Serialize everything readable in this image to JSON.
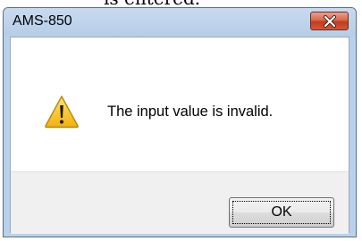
{
  "page": {
    "top_text": "is entered."
  },
  "dialog": {
    "title": "AMS-850",
    "message": "The input value is invalid.",
    "ok_label": "OK",
    "icon": "warning-icon",
    "close_icon": "close-icon"
  },
  "colors": {
    "titlebar": "#b9d1ea",
    "close_button": "#c94a2c",
    "button_area": "#f0f0f0",
    "warning_yellow": "#f5c21a"
  }
}
